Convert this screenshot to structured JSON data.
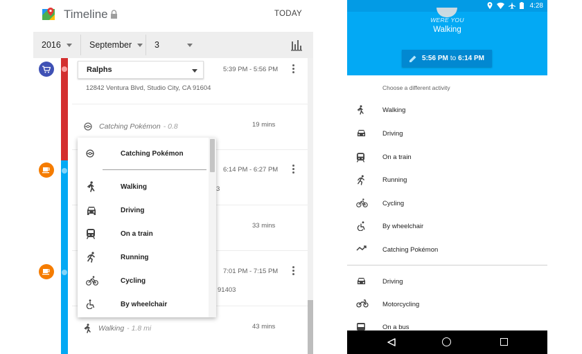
{
  "left": {
    "title": "Timeline",
    "today_label": "TODAY",
    "date": {
      "year": "2016",
      "month": "September",
      "day": "3"
    },
    "entries": [
      {
        "place": "Ralphs",
        "address": "12842 Ventura Blvd, Studio City, CA 91604",
        "time": "5:39 PM - 5:56 PM"
      },
      {
        "activity": "Catching Pokémon",
        "distance": "- 0.8",
        "duration": "19 mins"
      },
      {
        "time": "6:14 PM - 6:27 PM",
        "fragment": "3"
      },
      {
        "duration": "33 mins"
      },
      {
        "time": "7:01 PM - 7:15 PM",
        "fragment": "91403"
      },
      {
        "activity": "Walking",
        "distance": "- 1.8 mi",
        "duration": "43 mins"
      }
    ],
    "dropdown": {
      "selected": "Catching Pokémon",
      "items": [
        "Walking",
        "Driving",
        "On a train",
        "Running",
        "Cycling",
        "By wheelchair"
      ]
    },
    "colors": {
      "timeline_red": "#d32f2f",
      "timeline_blue": "#03a9f4",
      "shopping_icon": "#3f51b5",
      "cafe_icon": "#f57c00"
    }
  },
  "right": {
    "status_time": "4:28",
    "prompt": "WERE YOU",
    "activity": "Walking",
    "time_start": "5:56 PM",
    "time_to": "to",
    "time_end": "6:14 PM",
    "choose_label": "Choose a different activity",
    "activities": [
      "Walking",
      "Driving",
      "On a train",
      "Running",
      "Cycling",
      "By wheelchair",
      "Catching Pokémon"
    ],
    "more_activities": [
      "Driving",
      "Motorcycling",
      "On a bus"
    ],
    "colors": {
      "header": "#03a9f4",
      "button": "#0288d1"
    }
  }
}
